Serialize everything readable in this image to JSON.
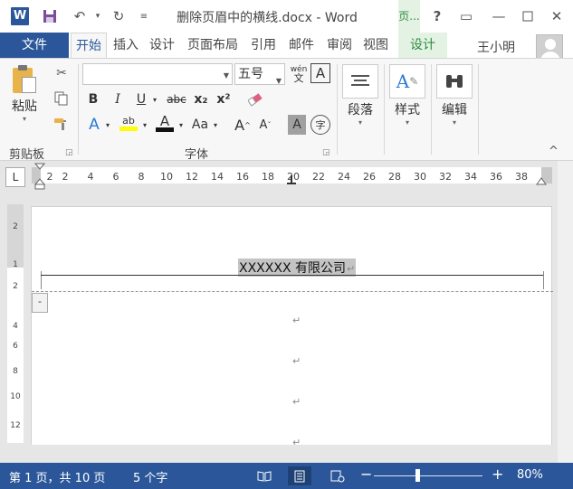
{
  "app": {
    "logo": "W",
    "title": "删除页眉中的横线.docx - Word",
    "context_tab_label": "页..."
  },
  "quick_access": {
    "undo_label": "↶",
    "redo_label": "↻"
  },
  "window_controls": {
    "help": "?",
    "restore_ribbon": "▭",
    "minimize": "—"
  },
  "tabs": {
    "file": "文件",
    "items": [
      "开始",
      "插入",
      "设计",
      "页面布局",
      "引用",
      "邮件",
      "审阅",
      "视图",
      "设计"
    ],
    "active_index": 0
  },
  "user": {
    "name": "王小明"
  },
  "ribbon": {
    "clipboard": {
      "paste_label": "粘贴",
      "group_label": "剪贴板"
    },
    "font": {
      "font_name": "",
      "font_size": "五号",
      "bold": "B",
      "italic": "I",
      "underline": "U",
      "strike": "abc",
      "subscript": "x₂",
      "superscript": "x²",
      "font_color": "A",
      "change_case": "Aa",
      "grow": "A",
      "shrink": "A",
      "char_shading": "A",
      "enclose": "字",
      "phonetic_top": "wén",
      "phonetic_bottom": "文",
      "border": "A",
      "group_label": "字体"
    },
    "paragraph": {
      "label": "段落"
    },
    "styles": {
      "label": "样式"
    },
    "editing": {
      "label": "编辑"
    },
    "collapse": "^"
  },
  "ruler": {
    "tab_selector": "L",
    "ticks": [
      "2",
      "2",
      "4",
      "6",
      "8",
      "10",
      "12",
      "14",
      "16",
      "18",
      "20",
      "22",
      "24",
      "26",
      "28",
      "30",
      "32",
      "34",
      "36",
      "38"
    ],
    "vticks": [
      "2",
      "1",
      "2",
      "4",
      "6",
      "8",
      "10",
      "12"
    ]
  },
  "document": {
    "header_text": "XXXXXX 有限公司",
    "paragraph_mark": "↵",
    "header_tag": "-"
  },
  "status": {
    "page": "第 1 页，共 10 页",
    "words": "5 个字",
    "zoom": "80%",
    "zoom_fraction": 0.4
  },
  "colors": {
    "brand": "#2b579a",
    "context_green": "#2e8b3e",
    "highlight_yellow": "#ffff00",
    "font_red": "#c00000"
  }
}
